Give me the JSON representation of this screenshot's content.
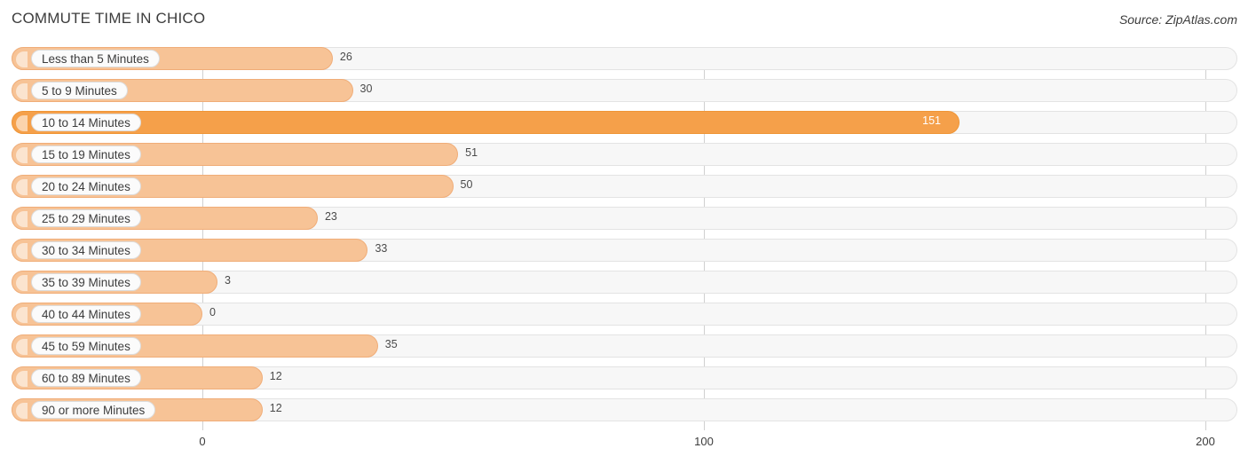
{
  "chart_data": {
    "type": "bar",
    "orientation": "horizontal",
    "title": "COMMUTE TIME IN CHICO",
    "source": "Source: ZipAtlas.com",
    "xlabel": "",
    "ylabel": "",
    "xlim": [
      0,
      200
    ],
    "ticks": [
      0,
      100,
      200
    ],
    "tick_labels": [
      "0",
      "100",
      "200"
    ],
    "grid": true,
    "legend": "none",
    "categories": [
      "Less than 5 Minutes",
      "5 to 9 Minutes",
      "10 to 14 Minutes",
      "15 to 19 Minutes",
      "20 to 24 Minutes",
      "25 to 29 Minutes",
      "30 to 34 Minutes",
      "35 to 39 Minutes",
      "40 to 44 Minutes",
      "45 to 59 Minutes",
      "60 to 89 Minutes",
      "90 or more Minutes"
    ],
    "values": [
      26,
      30,
      151,
      51,
      50,
      23,
      33,
      3,
      0,
      35,
      12,
      12
    ],
    "value_labels": [
      "26",
      "30",
      "151",
      "51",
      "50",
      "23",
      "33",
      "3",
      "0",
      "35",
      "12",
      "12"
    ],
    "max_value_index": 2,
    "colors": {
      "bar": "#f7c396",
      "bar_border": "#f0ad78",
      "bar_max": "#f5a04a",
      "bar_max_border": "#ef9536",
      "track": "#f7f7f7",
      "track_border": "#e3e3e3",
      "grid": "#d0d0d0",
      "text": "#3c3c3c"
    }
  }
}
